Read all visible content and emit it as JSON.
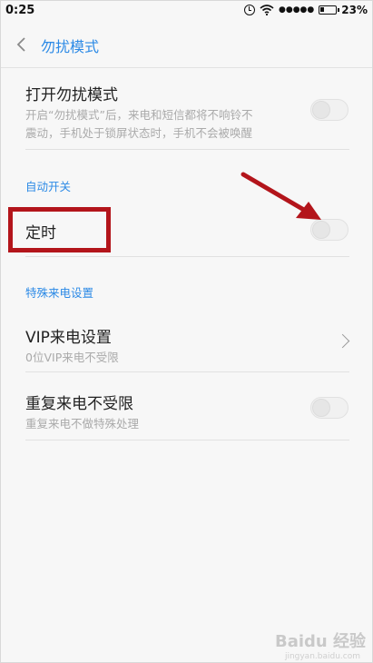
{
  "status_bar": {
    "time": "0:25",
    "signal": "●●●●●",
    "battery": "23%"
  },
  "header": {
    "title": "勿扰模式"
  },
  "settings": {
    "dnd": {
      "title": "打开勿扰模式",
      "desc_line1": "开启“勿扰模式”后，来电和短信都将不响铃不",
      "desc_line2": "震动，手机处于锁屏状态时，手机不会被唤醒",
      "enabled": false
    },
    "auto_section": "自动开关",
    "timer": {
      "title": "定时",
      "enabled": false
    },
    "special_section": "特殊来电设置",
    "vip": {
      "title": "VIP来电设置",
      "desc": "0位VIP来电不受限"
    },
    "repeat": {
      "title": "重复来电不受限",
      "desc": "重复来电不做特殊处理",
      "enabled": false
    }
  },
  "annotation": {
    "highlight_color": "#b3151b"
  },
  "watermark": {
    "text": "Baidu 经验",
    "sub": "jingyan.baidu.com"
  }
}
